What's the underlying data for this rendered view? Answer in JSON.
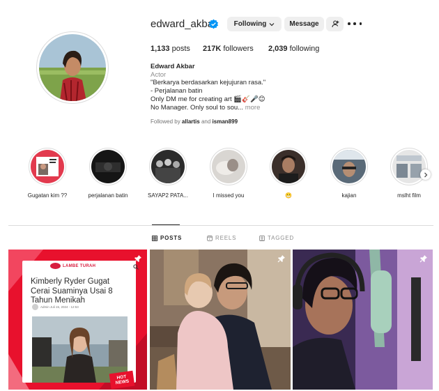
{
  "profile": {
    "username": "edward_akbar",
    "verified": true,
    "following_button": "Following",
    "message_button": "Message",
    "stats": {
      "posts_count": "1,133",
      "posts_label": "posts",
      "followers_count": "217K",
      "followers_label": "followers",
      "following_count": "2,039",
      "following_label": "following"
    },
    "bio": {
      "name": "Edward Akbar",
      "category": "Actor",
      "line1": "\"Berkarya berdasarkan kejujuran rasa.\"",
      "line2": "- Perjalanan batin",
      "line3": "Only DM me for creating art 🎬🎸🎤😊",
      "line4": "No Manager. Only soul to sou...",
      "more": "more"
    },
    "followed_by_prefix": "Followed by",
    "followed_by_user1": "allartis",
    "followed_by_and": "and",
    "followed_by_user2": "isman899"
  },
  "highlights": [
    {
      "label": "Gugatan kim ??"
    },
    {
      "label": "perjalanan batin"
    },
    {
      "label": "SAYAP2 PATA..."
    },
    {
      "label": "I missed you"
    },
    {
      "label": "😬"
    },
    {
      "label": "kajian"
    },
    {
      "label": "mslht film"
    }
  ],
  "tabs": [
    {
      "label": "POSTS",
      "active": true,
      "icon": "grid-icon"
    },
    {
      "label": "REELS",
      "active": false,
      "icon": "reels-icon"
    },
    {
      "label": "TAGGED",
      "active": false,
      "icon": "tagged-icon"
    }
  ],
  "posts": {
    "news_logo": "LAMBE TURAH",
    "news_headline": "Kimberly Ryder Gugat Cerai Suaminya Usai 8 Tahun Menikah",
    "news_meta": "Admin  Juli 15, 2024 - 12:53",
    "hot_news": "HOT NEWS"
  },
  "colors": {
    "verified_blue": "#0095f6",
    "button_gray": "#efefef",
    "news_red": "#e8112d"
  }
}
